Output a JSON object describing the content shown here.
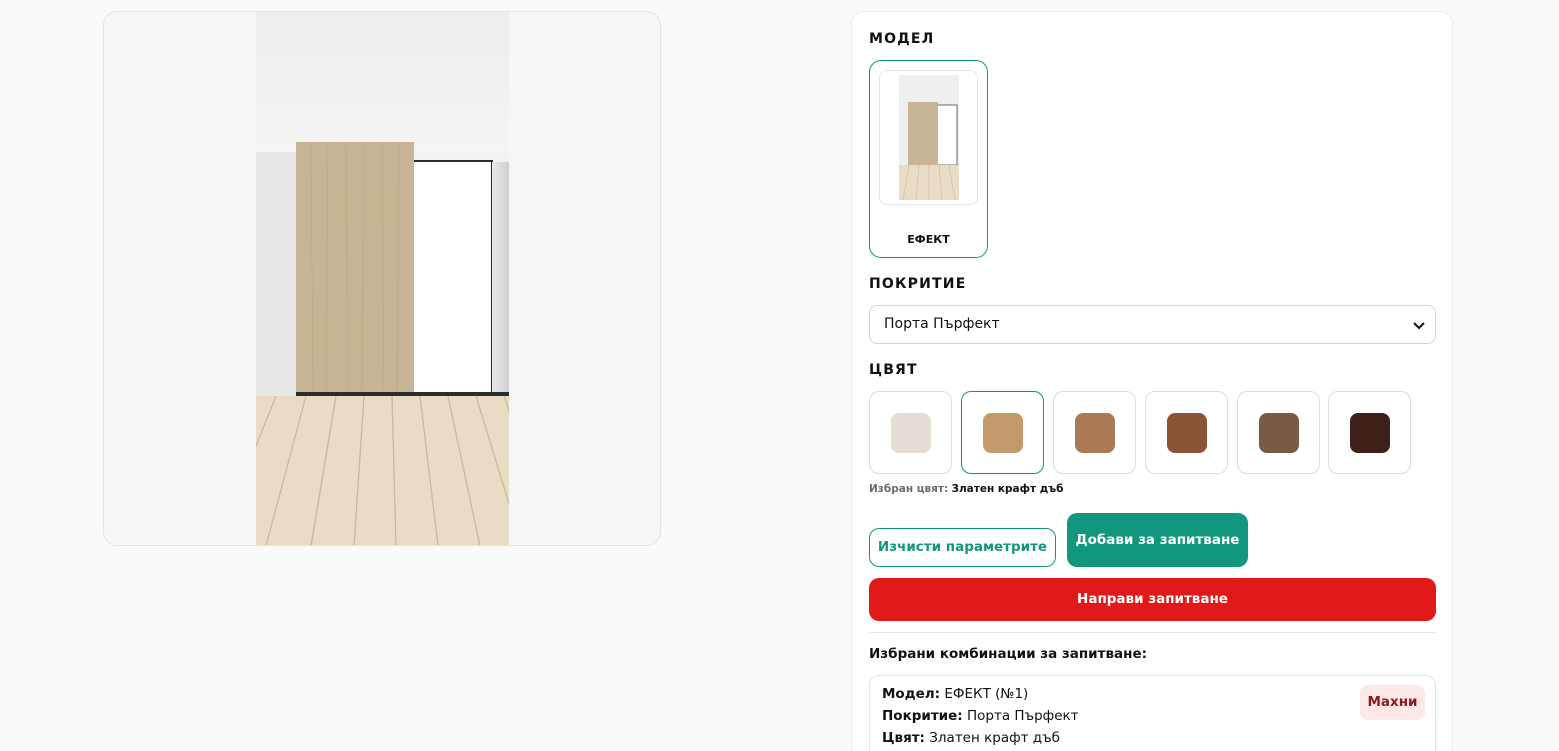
{
  "model": {
    "title": "МОДЕЛ",
    "options": [
      {
        "label": "ЕФЕКТ",
        "selected": true
      }
    ]
  },
  "coating": {
    "title": "ПОКРИТИЕ",
    "selected": "Порта Пърфект"
  },
  "color": {
    "title": "ЦВЯТ",
    "swatches": [
      {
        "name": "swatch-white-oak",
        "hex": "#e3ddd6",
        "selected": false
      },
      {
        "name": "swatch-golden-craft-oak",
        "hex": "#c49a6c",
        "selected": true
      },
      {
        "name": "swatch-light-walnut",
        "hex": "#a87a55",
        "selected": false
      },
      {
        "name": "swatch-walnut",
        "hex": "#8a5536",
        "selected": false
      },
      {
        "name": "swatch-dark-oak",
        "hex": "#7a5a44",
        "selected": false
      },
      {
        "name": "swatch-wenge",
        "hex": "#3f1f1a",
        "selected": false
      }
    ],
    "selected_label": "Избран цвят:",
    "selected_value": "Златен крафт дъб"
  },
  "buttons": {
    "clear": "Изчисти параметрите",
    "add": "Добави за запитване",
    "inquiry": "Направи запитване"
  },
  "combinations": {
    "title": "Избрани комбинации за запитване:",
    "items": [
      {
        "model_label": "Модел:",
        "model_value": "ЕФЕКТ (№1)",
        "coating_label": "Покритие:",
        "coating_value": "Порта Пърфект",
        "color_label": "Цвят:",
        "color_value": "Златен крафт дъб",
        "remove": "Махни"
      }
    ]
  },
  "colors": {
    "accent": "#12977e",
    "danger": "#e31919",
    "door": "#c8b596",
    "floor": "#e9dcc5"
  }
}
